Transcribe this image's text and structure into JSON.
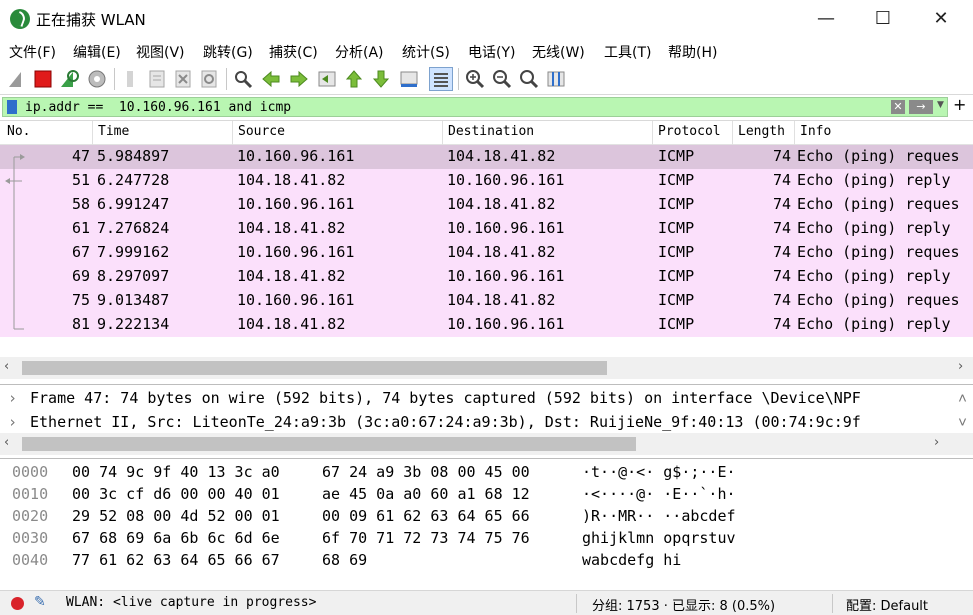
{
  "window": {
    "title": "正在捕获 WLAN",
    "minimize": "—",
    "maximize": "☐",
    "close": "✕"
  },
  "menu": [
    "文件(F)",
    "编辑(E)",
    "视图(V)",
    "跳转(G)",
    "捕获(C)",
    "分析(A)",
    "统计(S)",
    "电话(Y)",
    "无线(W)",
    "工具(T)",
    "帮助(H)"
  ],
  "toolbar_icons": [
    "shark-fin-icon",
    "stop-capture-icon",
    "restart-capture-icon",
    "capture-options-icon",
    "open-file-icon",
    "save-file-icon",
    "close-file-icon",
    "reload-icon",
    "find-icon",
    "back-icon",
    "forward-icon",
    "go-to-packet-icon",
    "first-packet-icon",
    "last-packet-icon",
    "autoscroll-icon",
    "colorize-icon",
    "zoom-in-icon",
    "zoom-out-icon",
    "normal-size-icon",
    "resize-columns-icon"
  ],
  "filter": {
    "value": "ip.addr ==  10.160.96.161 and icmp",
    "clear_label": "✕",
    "apply_label": "→",
    "dropdown": "▼",
    "add": "+"
  },
  "packet_list": {
    "columns": [
      "No.",
      "Time",
      "Source",
      "Destination",
      "Protocol",
      "Length",
      "Info"
    ],
    "rows": [
      {
        "no": "47",
        "time": "5.984897",
        "source": "10.160.96.161",
        "destination": "104.18.41.82",
        "protocol": "ICMP",
        "length": "74",
        "info": "Echo (ping) reques"
      },
      {
        "no": "51",
        "time": "6.247728",
        "source": "104.18.41.82",
        "destination": "10.160.96.161",
        "protocol": "ICMP",
        "length": "74",
        "info": "Echo (ping) reply"
      },
      {
        "no": "58",
        "time": "6.991247",
        "source": "10.160.96.161",
        "destination": "104.18.41.82",
        "protocol": "ICMP",
        "length": "74",
        "info": "Echo (ping) reques"
      },
      {
        "no": "61",
        "time": "7.276824",
        "source": "104.18.41.82",
        "destination": "10.160.96.161",
        "protocol": "ICMP",
        "length": "74",
        "info": "Echo (ping) reply"
      },
      {
        "no": "67",
        "time": "7.999162",
        "source": "10.160.96.161",
        "destination": "104.18.41.82",
        "protocol": "ICMP",
        "length": "74",
        "info": "Echo (ping) reques"
      },
      {
        "no": "69",
        "time": "8.297097",
        "source": "104.18.41.82",
        "destination": "10.160.96.161",
        "protocol": "ICMP",
        "length": "74",
        "info": "Echo (ping) reply"
      },
      {
        "no": "75",
        "time": "9.013487",
        "source": "10.160.96.161",
        "destination": "104.18.41.82",
        "protocol": "ICMP",
        "length": "74",
        "info": "Echo (ping) reques"
      },
      {
        "no": "81",
        "time": "9.222134",
        "source": "104.18.41.82",
        "destination": "10.160.96.161",
        "protocol": "ICMP",
        "length": "74",
        "info": "Echo (ping) reply"
      }
    ]
  },
  "details": [
    "Frame 47: 74 bytes on wire (592 bits), 74 bytes captured (592 bits) on interface \\Device\\NPF",
    "Ethernet II, Src: LiteonTe_24:a9:3b (3c:a0:67:24:a9:3b), Dst: RuijieNe_9f:40:13 (00:74:9c:9f"
  ],
  "bytes": [
    {
      "offset": "0000",
      "hex1": "00 74 9c 9f 40 13 3c a0",
      "hex2": "67 24 a9 3b 08 00 45 00",
      "ascii": "·t··@·<· g$·;··E·"
    },
    {
      "offset": "0010",
      "hex1": "00 3c cf d6 00 00 40 01",
      "hex2": "ae 45 0a a0 60 a1 68 12",
      "ascii": "·<····@· ·E··`·h·"
    },
    {
      "offset": "0020",
      "hex1": "29 52 08 00 4d 52 00 01",
      "hex2": "00 09 61 62 63 64 65 66",
      "ascii": ")R··MR·· ··abcdef"
    },
    {
      "offset": "0030",
      "hex1": "67 68 69 6a 6b 6c 6d 6e",
      "hex2": "6f 70 71 72 73 74 75 76",
      "ascii": "ghijklmn opqrstuv"
    },
    {
      "offset": "0040",
      "hex1": "77 61 62 63 64 65 66 67",
      "hex2": "68 69",
      "ascii": "wabcdefg hi"
    }
  ],
  "status": {
    "interface": "WLAN: <live capture in progress>",
    "packets": "分组: 1753 · 已显示: 8 (0.5%)",
    "profile": "配置: Default"
  },
  "colors": {
    "filter_bg": "#b9f6b2",
    "row_bg": "#fbe0fb",
    "row_selected": "#dcc5dc"
  }
}
